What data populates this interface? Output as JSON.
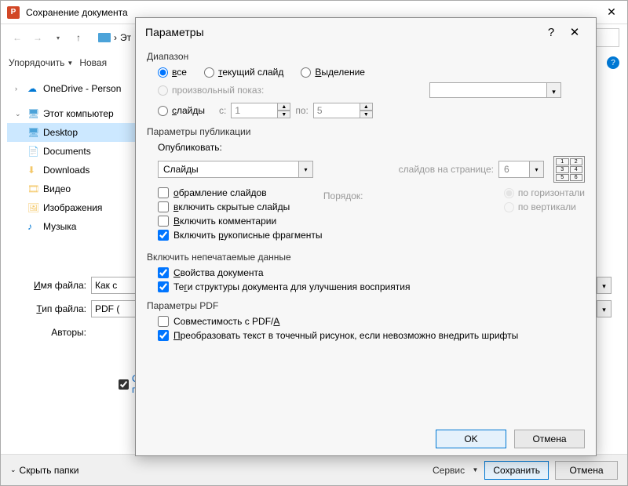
{
  "save": {
    "title": "Сохранение документа",
    "path_segment": "Эт",
    "organize": "Упорядочить",
    "new": "Новая",
    "tree": {
      "onedrive": "OneDrive - Person",
      "this_pc": "Этот компьютер",
      "desktop": "Desktop",
      "documents": "Documents",
      "downloads": "Downloads",
      "video": "Видео",
      "images": "Изображения",
      "music": "Музыка"
    },
    "filename_label_u": "И",
    "filename_label": "мя файла:",
    "filename_value": "Как с",
    "filetype_label_u": "Т",
    "filetype_label": "ип файла:",
    "filetype_value": "PDF (",
    "authors": "Авторы:",
    "open_after1": "Отк",
    "open_after2": "пуб",
    "hide_folders": "Скрыть папки",
    "service": "Сервис",
    "save_btn": "Сохранить",
    "cancel": "Отмена"
  },
  "params": {
    "title": "Параметры",
    "range": {
      "group": "Диапазон",
      "all_u": "в",
      "all": "се",
      "current_u": "т",
      "current": "екущий слайд",
      "selection_u": "В",
      "selection2": "ыделение",
      "custom": "произвольный показ:",
      "slides_u": "с",
      "slides": "лайды",
      "from": "с:",
      "from_val": "1",
      "to": "по:",
      "to_val": "5"
    },
    "pub": {
      "group": "Параметры публикации",
      "publish": "Опубликовать:",
      "publish_val": "Слайды",
      "perpage": "слайдов на странице:",
      "perpage_val": "6",
      "order": "Порядок:",
      "horiz": "по горизонтали",
      "vert": "по вертикали",
      "frame_u": "о",
      "frame": "брамление слайдов",
      "hidden_u": "в",
      "hidden": "ключить скрытые слайды",
      "comments_u": "В",
      "comments2": "ключить комментарии",
      "ink_u": "р",
      "ink1": "Включить ",
      "ink2": "укописные фрагменты"
    },
    "nonprint": {
      "group": "Включить непечатаемые данные",
      "props_u": "С",
      "props": "войства документа",
      "tags_u": "г",
      "tags1": "Те",
      "tags2": "и структуры документа для улучшения восприятия"
    },
    "pdf": {
      "group": "Параметры PDF",
      "pdfa_u": "A",
      "pdfa": "Совместимость с PDF/",
      "bitmap_u": "П",
      "bitmap": "реобразовать текст в точечный рисунок, если невозможно внедрить шрифты"
    },
    "ok": "OK",
    "cancel": "Отмена"
  }
}
